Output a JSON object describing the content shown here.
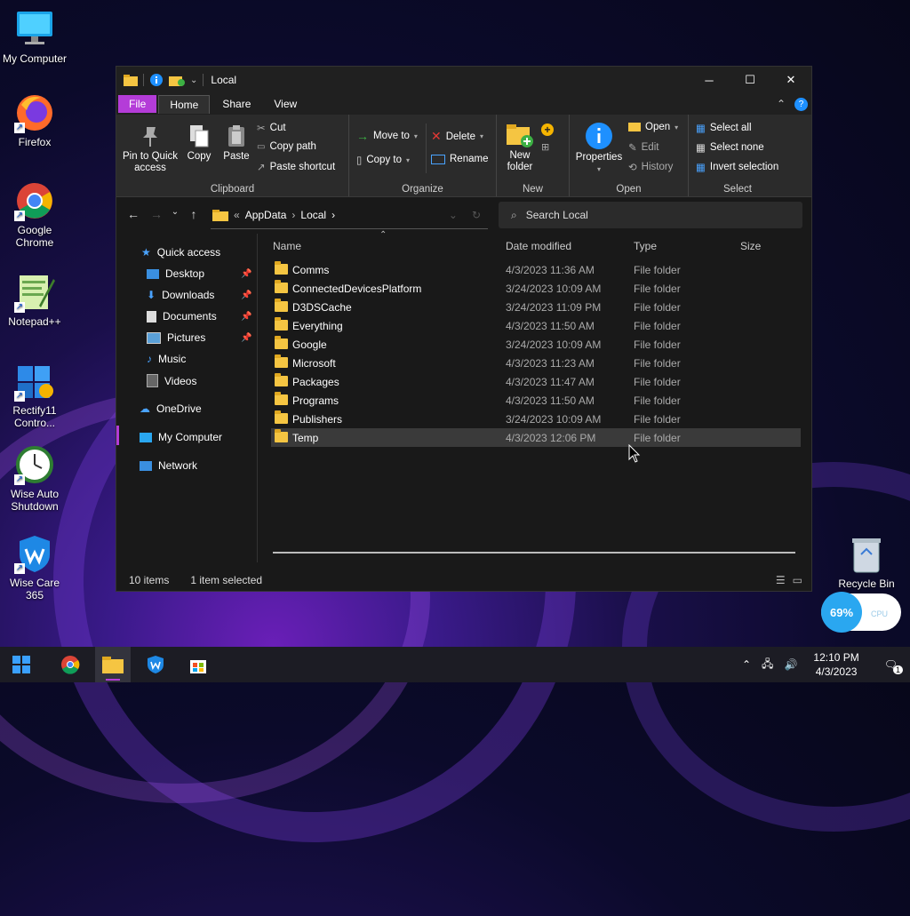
{
  "desktop": {
    "icons": [
      {
        "label": "My Computer",
        "icon": "monitor-icon"
      },
      {
        "label": "Firefox",
        "icon": "firefox-icon"
      },
      {
        "label": "Google Chrome",
        "icon": "chrome-icon"
      },
      {
        "label": "Notepad++",
        "icon": "notepadpp-icon"
      },
      {
        "label": "Rectify11 Contro...",
        "icon": "control-panel-icon"
      },
      {
        "label": "Wise Auto Shutdown",
        "icon": "clock-icon"
      },
      {
        "label": "Wise Care 365",
        "icon": "wisecare-icon"
      }
    ],
    "recycle_bin": "Recycle Bin",
    "cpu_widget": {
      "percent": "69%",
      "label": "CPU"
    }
  },
  "window": {
    "title": "Local",
    "tabs": {
      "file": "File",
      "home": "Home",
      "share": "Share",
      "view": "View"
    },
    "ribbon": {
      "clipboard": {
        "label": "Clipboard",
        "pin": "Pin to Quick access",
        "copy": "Copy",
        "paste": "Paste",
        "cut": "Cut",
        "copy_path": "Copy path",
        "paste_shortcut": "Paste shortcut"
      },
      "organize": {
        "label": "Organize",
        "move_to": "Move to",
        "copy_to": "Copy to",
        "delete": "Delete",
        "rename": "Rename"
      },
      "new": {
        "label": "New",
        "new_folder": "New folder"
      },
      "open": {
        "label": "Open",
        "properties": "Properties",
        "open": "Open",
        "edit": "Edit",
        "history": "History"
      },
      "select": {
        "label": "Select",
        "select_all": "Select all",
        "select_none": "Select none",
        "invert": "Invert selection"
      }
    },
    "address": {
      "segments": [
        "AppData",
        "Local"
      ],
      "overflow": "«"
    },
    "search": {
      "placeholder": "Search Local"
    },
    "nav": {
      "quick_access": "Quick access",
      "items": [
        "Desktop",
        "Downloads",
        "Documents",
        "Pictures",
        "Music",
        "Videos"
      ],
      "onedrive": "OneDrive",
      "my_computer": "My Computer",
      "network": "Network"
    },
    "columns": {
      "name": "Name",
      "date": "Date modified",
      "type": "Type",
      "size": "Size"
    },
    "files": [
      {
        "name": "Comms",
        "date": "4/3/2023 11:36 AM",
        "type": "File folder"
      },
      {
        "name": "ConnectedDevicesPlatform",
        "date": "3/24/2023 10:09 AM",
        "type": "File folder"
      },
      {
        "name": "D3DSCache",
        "date": "3/24/2023 11:09 PM",
        "type": "File folder"
      },
      {
        "name": "Everything",
        "date": "4/3/2023 11:50 AM",
        "type": "File folder"
      },
      {
        "name": "Google",
        "date": "3/24/2023 10:09 AM",
        "type": "File folder"
      },
      {
        "name": "Microsoft",
        "date": "4/3/2023 11:23 AM",
        "type": "File folder"
      },
      {
        "name": "Packages",
        "date": "4/3/2023 11:47 AM",
        "type": "File folder"
      },
      {
        "name": "Programs",
        "date": "4/3/2023 11:50 AM",
        "type": "File folder"
      },
      {
        "name": "Publishers",
        "date": "3/24/2023 10:09 AM",
        "type": "File folder"
      },
      {
        "name": "Temp",
        "date": "4/3/2023 12:06 PM",
        "type": "File folder"
      }
    ],
    "status": {
      "count": "10 items",
      "selected": "1 item selected"
    }
  },
  "taskbar": {
    "time": "12:10 PM",
    "date": "4/3/2023",
    "notifications": "1"
  }
}
